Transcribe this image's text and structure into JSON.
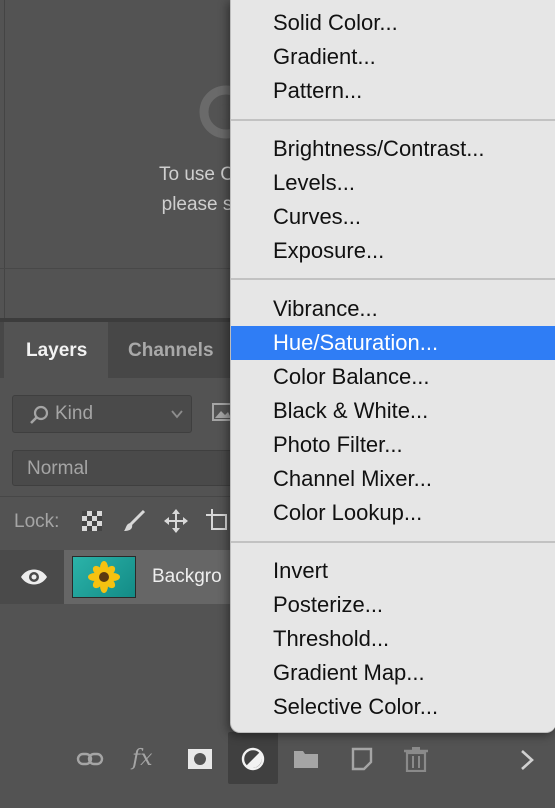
{
  "libraries": {
    "message_line1": "To use Creative",
    "message_line2": "please sign in t"
  },
  "layers_panel": {
    "tabs": [
      {
        "label": "Layers",
        "active": true
      },
      {
        "label": "Channels",
        "active": false
      }
    ],
    "kind_filter": {
      "value": "Kind",
      "icon": "search-icon"
    },
    "blend_mode": "Normal",
    "lock_label": "Lock:",
    "layer": {
      "name": "Backgro",
      "visible": true
    }
  },
  "adjustment_menu": {
    "groups": [
      [
        "Solid Color...",
        "Gradient...",
        "Pattern..."
      ],
      [
        "Brightness/Contrast...",
        "Levels...",
        "Curves...",
        "Exposure..."
      ],
      [
        "Vibrance...",
        "Hue/Saturation...",
        "Color Balance...",
        "Black & White...",
        "Photo Filter...",
        "Channel Mixer...",
        "Color Lookup..."
      ],
      [
        "Invert",
        "Posterize...",
        "Threshold...",
        "Gradient Map...",
        "Selective Color..."
      ]
    ],
    "highlighted": "Hue/Saturation..."
  },
  "bottom_toolbar": {
    "icons": [
      "link-icon",
      "fx-icon",
      "mask-icon",
      "adjustment-icon",
      "folder-icon",
      "new-layer-icon",
      "trash-icon"
    ],
    "fx_label": "fx"
  },
  "colors": {
    "panel_bg": "#535353",
    "menu_bg": "#e6e6e6",
    "highlight": "#2f7df5"
  }
}
